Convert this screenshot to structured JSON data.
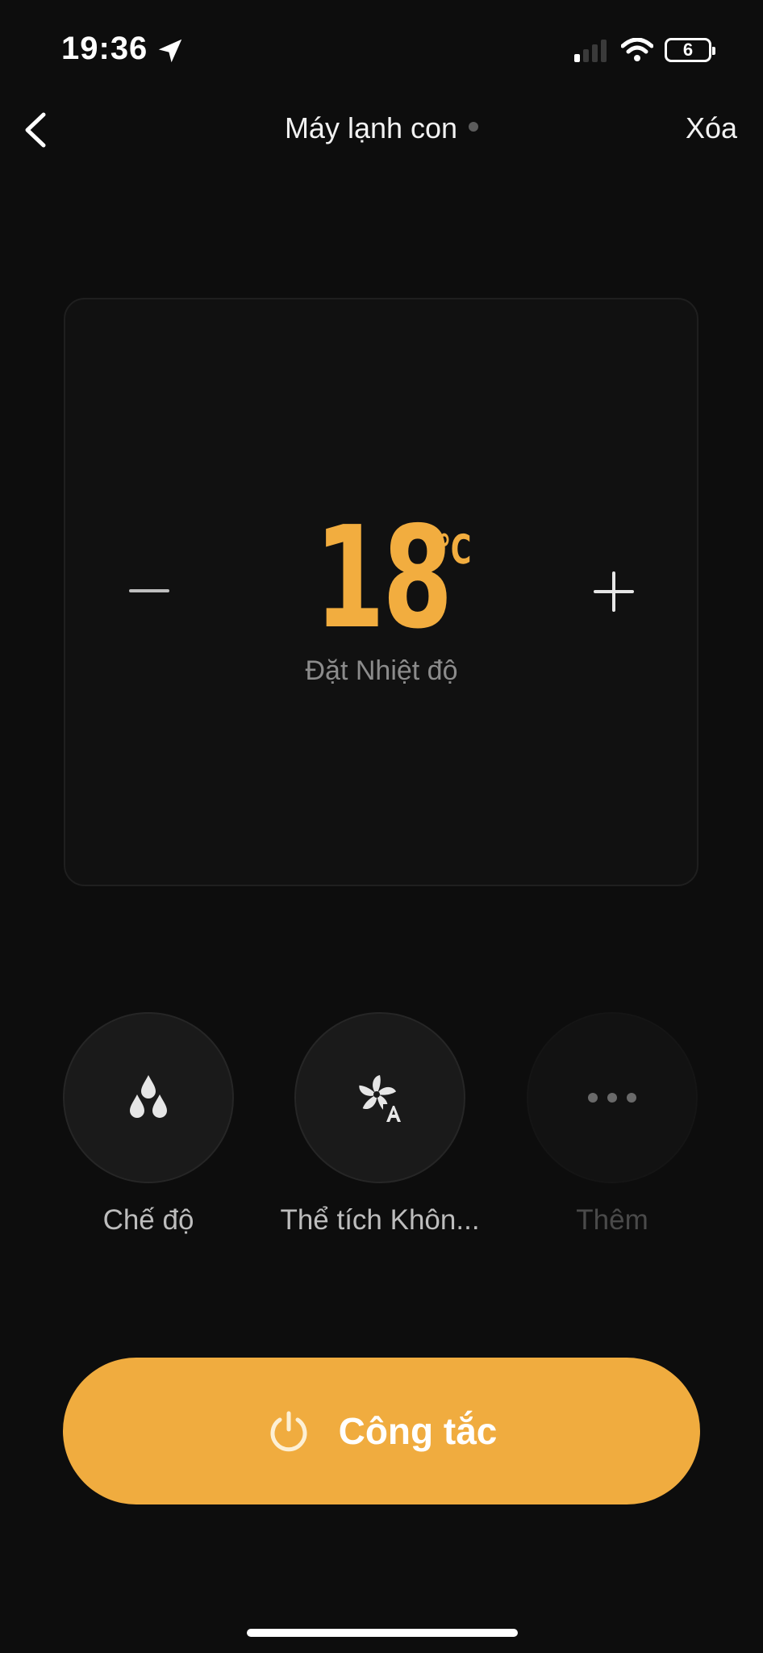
{
  "status_bar": {
    "time": "19:36",
    "battery_level": "6"
  },
  "header": {
    "title": "Máy lạnh con",
    "delete_label": "Xóa"
  },
  "temperature": {
    "value": "18",
    "unit": "℃",
    "label": "Đặt Nhiệt độ"
  },
  "functions": [
    {
      "label": "Chế độ",
      "icon": "water-drops-icon"
    },
    {
      "label": "Thể tích Khôn...",
      "icon": "fan-auto-icon"
    },
    {
      "label": "Thêm",
      "icon": "more-dots-icon"
    }
  ],
  "power_button": {
    "label": "Công tắc",
    "icon": "power-icon"
  },
  "colors": {
    "accent": "#f0ac3f",
    "background": "#0d0d0d",
    "card": "#111111"
  }
}
